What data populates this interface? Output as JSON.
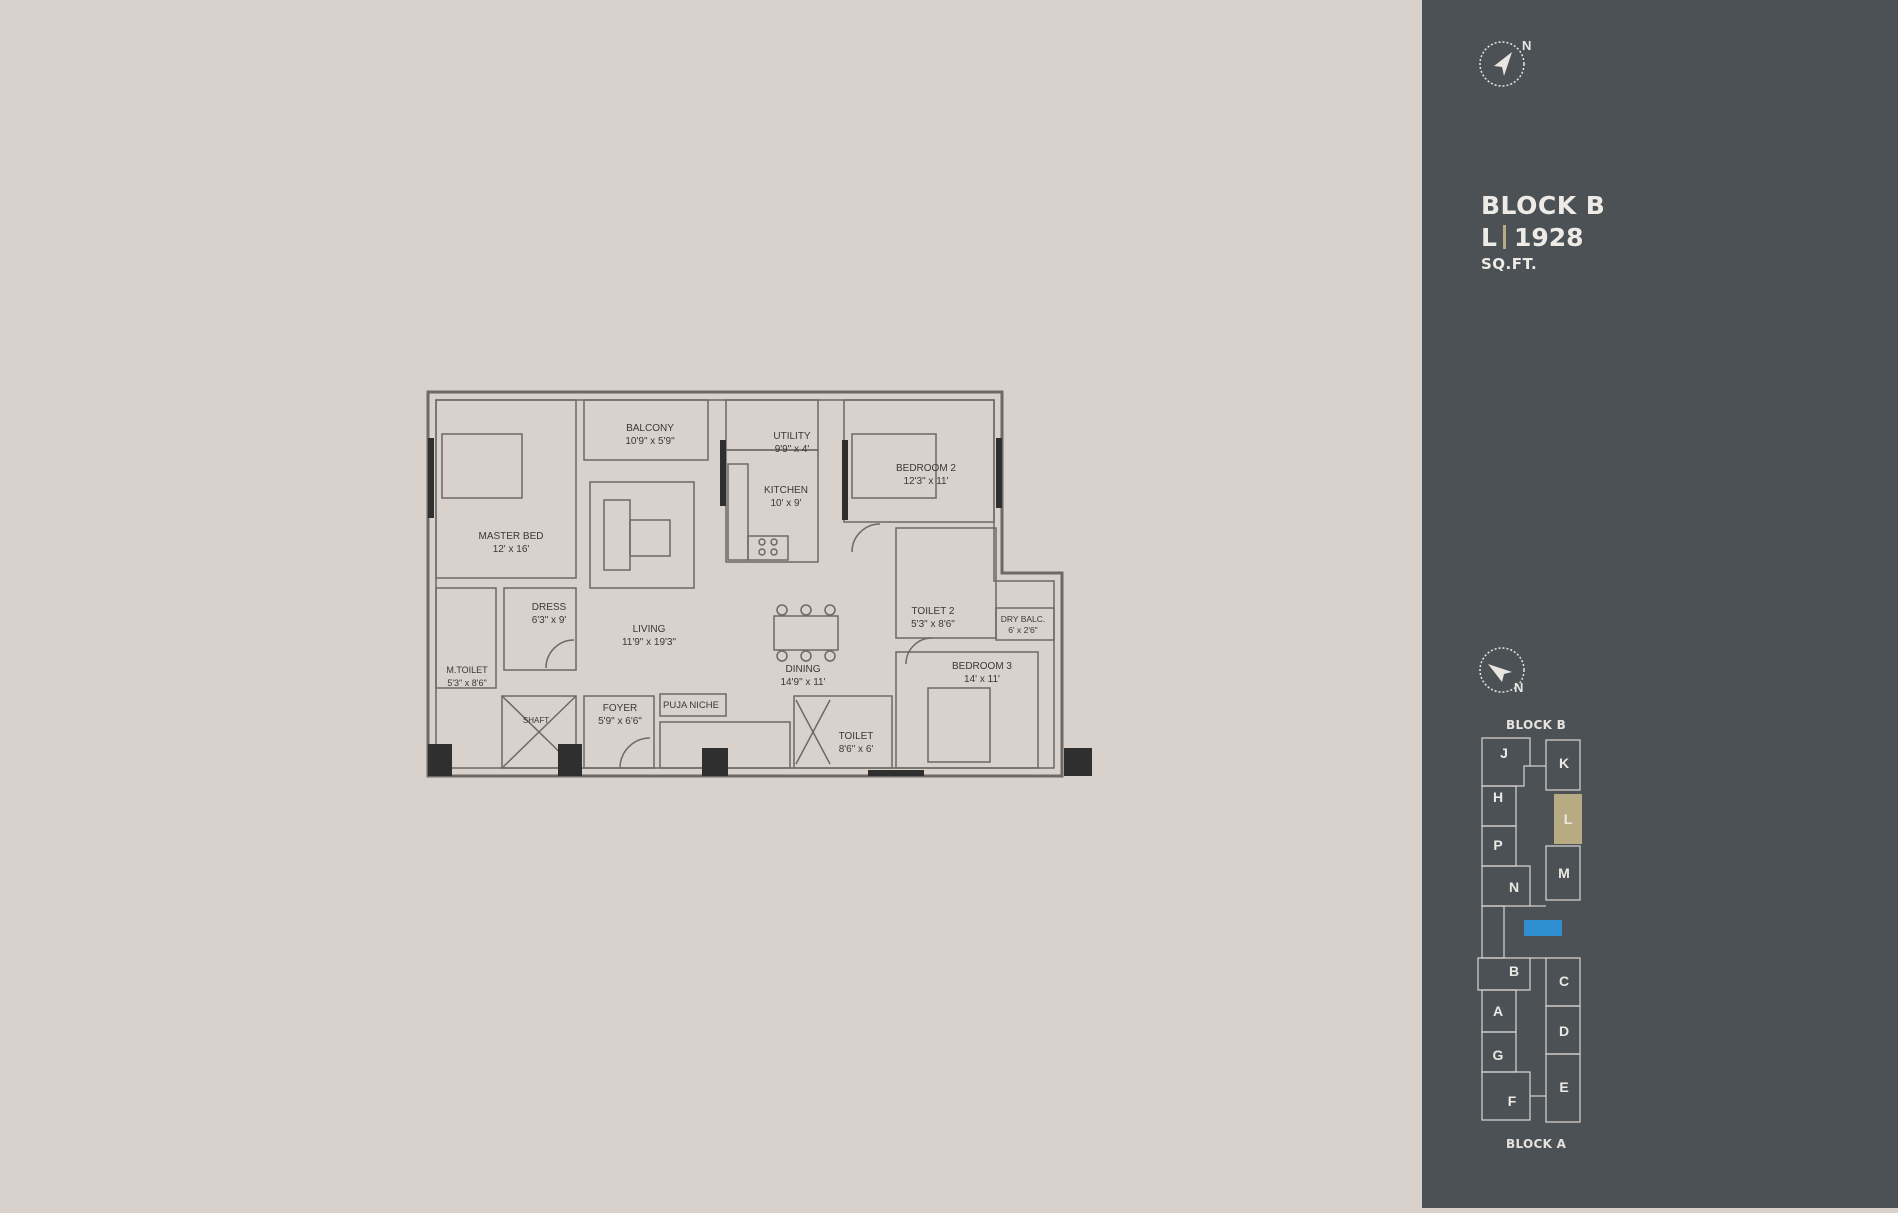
{
  "colors": {
    "background": "#d9d1cb",
    "sidebar": "#4b5154",
    "accent_unit": "#b8aa82",
    "pool": "#2f8fd1",
    "wall": "#2f2f2f",
    "line": "#6d6966"
  },
  "sidebar": {
    "compass_top_letter": "N",
    "block_name": "BLOCK B",
    "unit_letter": "L",
    "area_value": "1928",
    "area_unit": "SQ.FT.",
    "compass_bottom_letter": "N",
    "site_top_label": "BLOCK B",
    "site_bottom_label": "BLOCK A",
    "site_units": [
      "J",
      "K",
      "H",
      "L",
      "P",
      "M",
      "N",
      "B",
      "C",
      "A",
      "D",
      "G",
      "E",
      "F"
    ],
    "highlighted_unit": "L"
  },
  "rooms": {
    "balcony": {
      "name": "BALCONY",
      "size": "10'9\" x 5'9\""
    },
    "utility": {
      "name": "UTILITY",
      "size": "9'9\" x 4'"
    },
    "kitchen": {
      "name": "KITCHEN",
      "size": "10' x 9'"
    },
    "bedroom2": {
      "name": "BEDROOM 2",
      "size": "12'3\" x 11'"
    },
    "master_bed": {
      "name": "MASTER BED",
      "size": "12' x 16'"
    },
    "dress": {
      "name": "DRESS",
      "size": "6'3\" x 9'"
    },
    "living": {
      "name": "LIVING",
      "size": "11'9\" x 19'3\""
    },
    "toilet2": {
      "name": "TOILET 2",
      "size": "5'3\" x 8'6\""
    },
    "dry_balc": {
      "name": "DRY BALC.",
      "size": "6' x 2'6\""
    },
    "bedroom3": {
      "name": "BEDROOM 3",
      "size": "14' x 11'"
    },
    "dining": {
      "name": "DINING",
      "size": "14'9\" x 11'"
    },
    "m_toilet": {
      "name": "M.TOILET",
      "size": "5'3\" x 8'6\""
    },
    "foyer": {
      "name": "FOYER",
      "size": "5'9\" x 6'6\""
    },
    "puja": {
      "name": "PUJA NICHE"
    },
    "shaft": {
      "name": "SHAFT"
    },
    "toilet": {
      "name": "TOILET",
      "size": "8'6\" x 6'"
    }
  }
}
